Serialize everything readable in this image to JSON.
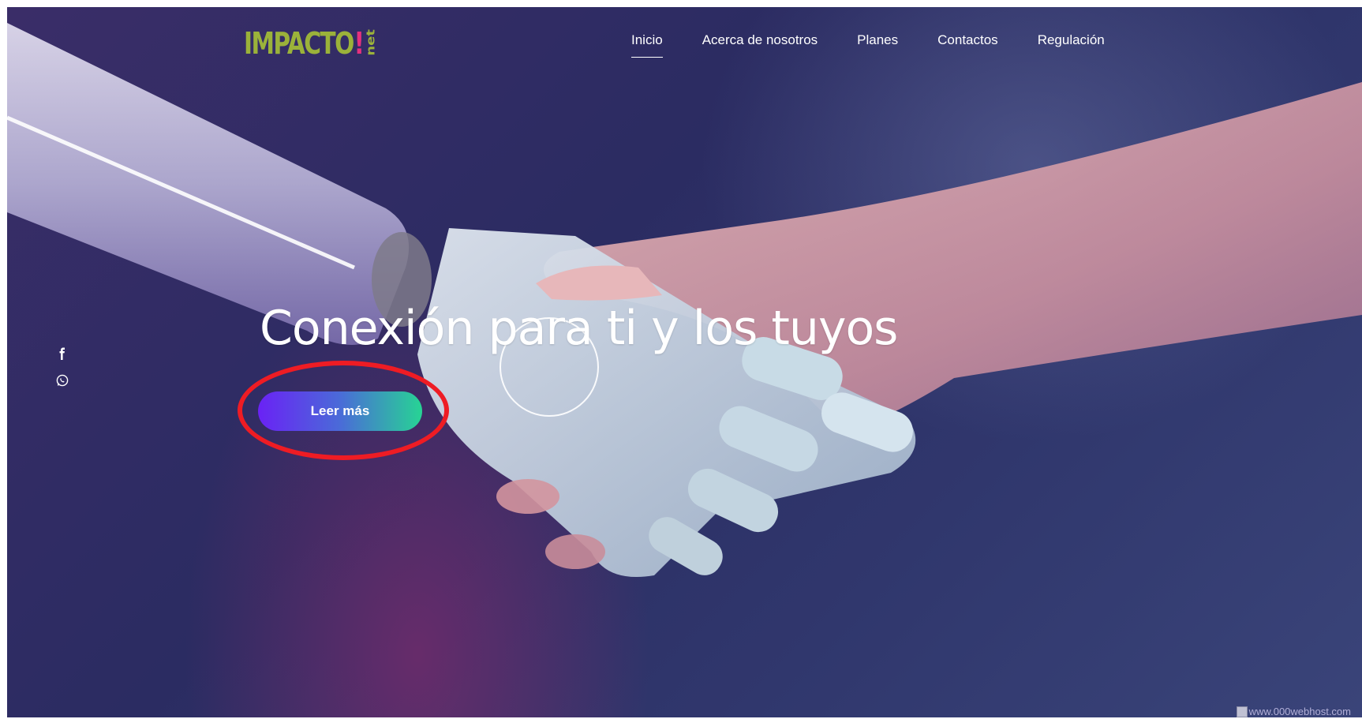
{
  "brand": {
    "logo_main": "IMPACTO",
    "logo_bang": "!",
    "logo_suffix": "net"
  },
  "nav": {
    "items": [
      {
        "label": "Inicio",
        "active": true
      },
      {
        "label": "Acerca de nosotros",
        "active": false
      },
      {
        "label": "Planes",
        "active": false
      },
      {
        "label": "Contactos",
        "active": false
      },
      {
        "label": "Regulación",
        "active": false
      }
    ]
  },
  "social": {
    "icons": [
      "facebook-icon",
      "whatsapp-icon"
    ]
  },
  "hero": {
    "headline": "Conexión para ti y los tuyos",
    "cta_label": "Leer más"
  },
  "annotation": {
    "highlight_color": "#ee1c24"
  },
  "footer": {
    "host_badge": "www.000webhost.com"
  },
  "colors": {
    "logo_green": "#9bb23a",
    "logo_pink": "#e5317d",
    "cta_gradient_start": "#6a22f5",
    "cta_gradient_end": "#27d494"
  }
}
